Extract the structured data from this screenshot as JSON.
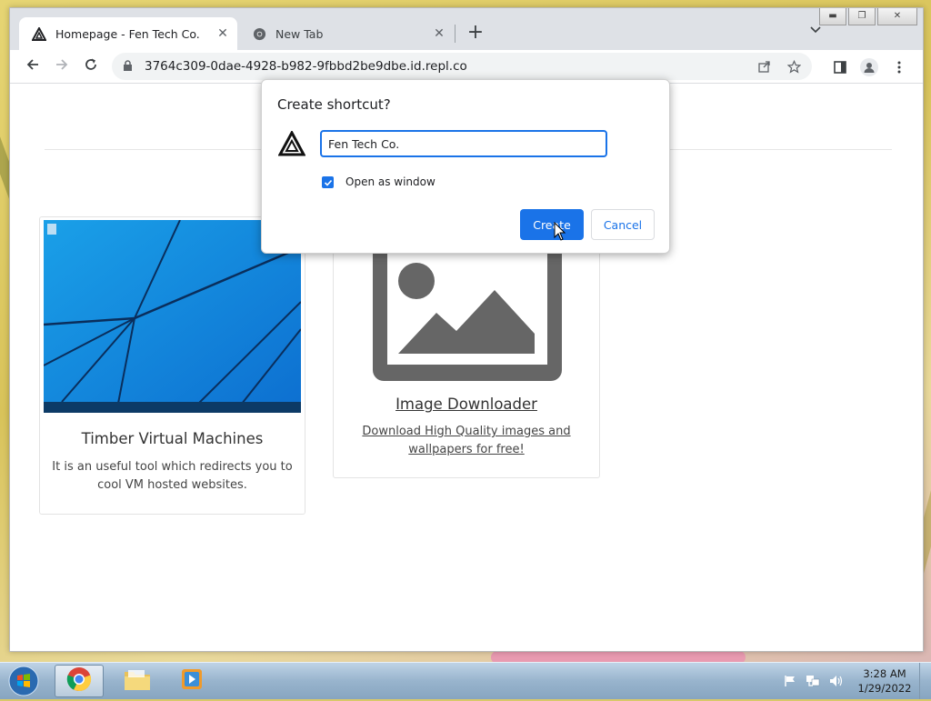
{
  "browser": {
    "tabs": [
      {
        "title": "Homepage - Fen Tech Co.",
        "active": true,
        "icon": "fen-tech-logo-icon"
      },
      {
        "title": "New Tab",
        "active": false,
        "icon": "chrome-icon"
      }
    ],
    "new_tab_label": "+",
    "url": "3764c309-0dae-4928-b982-9fbbd2be9dbe.id.repl.co"
  },
  "page": {
    "cards": [
      {
        "title": "Timber Virtual Machines",
        "description": "It is an useful tool which redirects you to cool VM hosted websites."
      },
      {
        "title": "Image Downloader",
        "description": "Download High Quality images and wallpapers for free!"
      }
    ]
  },
  "dialog": {
    "title": "Create shortcut?",
    "name_value": "Fen Tech Co.",
    "open_as_window_label": "Open as window",
    "open_as_window_checked": true,
    "create_label": "Create",
    "cancel_label": "Cancel"
  },
  "taskbar": {
    "items": [
      "chrome-icon",
      "folder-icon",
      "media-player-icon"
    ],
    "time": "3:28 AM",
    "date": "1/29/2022"
  },
  "colors": {
    "accent": "#1a73e8",
    "tabstrip": "#dee1e6"
  }
}
